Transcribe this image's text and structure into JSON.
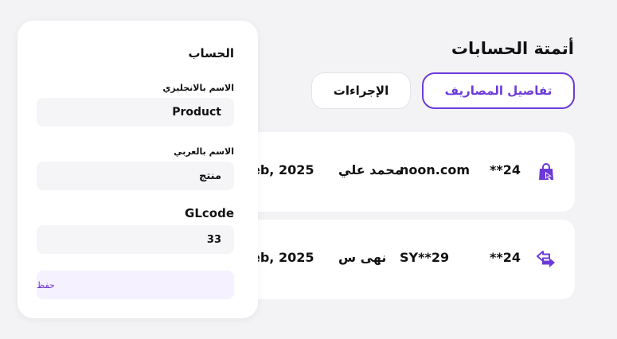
{
  "page": {
    "title": "أتمتة الحسابات"
  },
  "tabs": [
    {
      "label": "تفاصيل المصاريف",
      "active": true
    },
    {
      "label": "الإجراءات",
      "active": false
    }
  ],
  "transactions": [
    {
      "icon": "shopping-bag-icon",
      "amount": "**24",
      "merchant": "noon.com",
      "name": "محمد علي",
      "date": "eb, 2025"
    },
    {
      "icon": "transfer-arrows-icon",
      "amount": "**24",
      "merchant": "SY**29",
      "name": "نهى س",
      "date": "eb, 2025"
    }
  ],
  "account_panel": {
    "title": "الحساب",
    "english_name_label": "الاسم بالانجليزي",
    "english_name_value": "Product",
    "arabic_name_label": "الاسم بالعربي",
    "arabic_name_value": "منتج",
    "glcode_label": "GLcode",
    "glcode_value": "33",
    "save_label": "حفظ"
  },
  "colors": {
    "accent": "#6c3ad8",
    "background": "#f3f3f5",
    "field": "#f5f5f7",
    "save_bg": "#f5f1fe"
  }
}
